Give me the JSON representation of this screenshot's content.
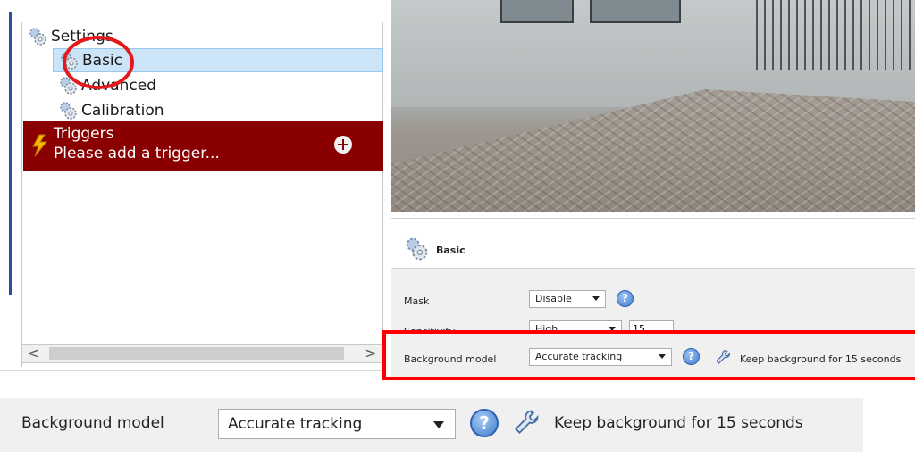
{
  "tree": {
    "settings_label": "Settings",
    "basic_label": "Basic",
    "advanced_label": "Advanced",
    "calibration_label": "Calibration",
    "triggers_label": "Triggers",
    "triggers_sub": "Please add a trigger...",
    "scroll_left": "<",
    "scroll_right": ">"
  },
  "panel": {
    "title": "Basic",
    "mask_label": "Mask",
    "mask_value": "Disable",
    "sensitivity_label": "Sensitivity",
    "sensitivity_value": "High",
    "sensitivity_number": "15",
    "bg_model_label": "Background model",
    "bg_model_value": "Accurate tracking",
    "keep_text": "Keep background for 15 seconds",
    "help_glyph": "?"
  },
  "zoom": {
    "bg_model_label": "Background model",
    "bg_model_value": "Accurate tracking",
    "keep_text": "Keep background for 15 seconds",
    "help_glyph": "?"
  },
  "colors": {
    "selected_row": "#cce4f7",
    "triggers_bg": "#8a0000",
    "highlight": "#ff0000",
    "panel_bg": "#f0f0f0"
  },
  "icons": [
    "gear-icon",
    "lightning-icon",
    "add-icon",
    "help-icon",
    "wrench-icon",
    "chevron-down-icon"
  ]
}
